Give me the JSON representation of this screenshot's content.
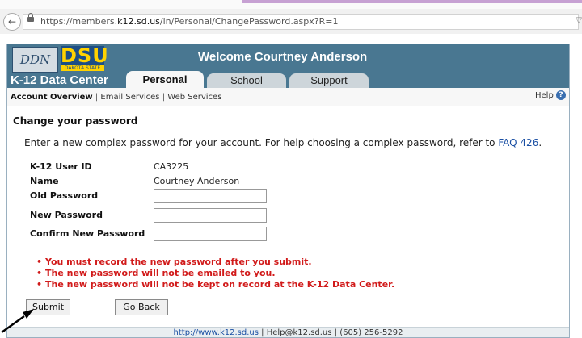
{
  "browser": {
    "url_prefix": "https://members.",
    "url_domain": "k12.sd.us",
    "url_path": "/in/Personal/ChangePassword.aspx?R=1"
  },
  "banner": {
    "logo_ddn": "DDN",
    "logo_dsu": "DSU",
    "logo_dsu_sub": "DAKOTA STATE",
    "welcome": "Welcome Courtney Anderson",
    "center_name": "K-12 Data Center"
  },
  "tabs": [
    {
      "label": "Personal",
      "active": true
    },
    {
      "label": "School",
      "active": false
    },
    {
      "label": "Support",
      "active": false
    }
  ],
  "subnav": {
    "account_overview": "Account Overview",
    "email_services": "Email Services",
    "web_services": "Web Services",
    "separator": "|",
    "help": "Help"
  },
  "form": {
    "heading": "Change your password",
    "intro": "Enter a new complex password for your account. For help choosing a complex password, refer to",
    "faq_link": "FAQ 426",
    "intro_end": ".",
    "user_id_label": "K-12 User ID",
    "user_id_value": "CA3225",
    "name_label": "Name",
    "name_value": "Courtney Anderson",
    "old_password_label": "Old Password",
    "new_password_label": "New Password",
    "confirm_password_label": "Confirm New Password"
  },
  "warnings": [
    "You must record the new password after you submit.",
    "The new password will not be emailed to you.",
    "The new password will not be kept on record at the K-12 Data Center."
  ],
  "buttons": {
    "submit": "Submit",
    "go_back": "Go Back"
  },
  "footer": {
    "link": "http://www.k12.sd.us",
    "email": "Help@k12.sd.us",
    "phone": "(605) 256-5292",
    "sep": "|"
  },
  "colors": {
    "banner": "#497791",
    "warning": "#d11a1a",
    "link": "#1a4fa3"
  }
}
